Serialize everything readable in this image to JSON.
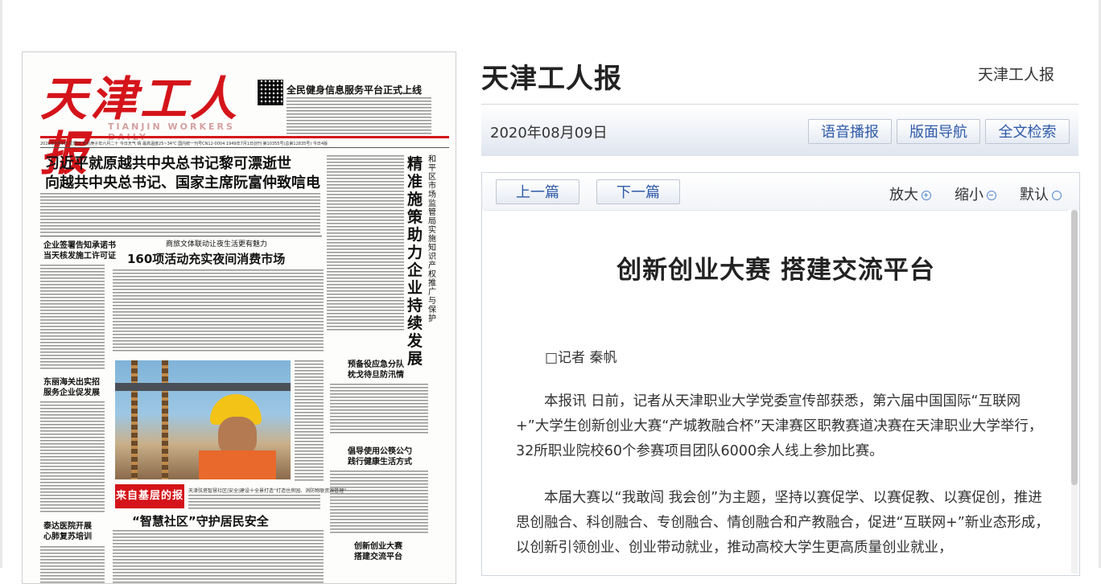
{
  "site": {
    "title": "天津工人报",
    "paper_name": "天津工人报"
  },
  "toolbar": {
    "date": "2020年08月09日",
    "buttons": [
      "语音播报",
      "版面导航",
      "全文检索"
    ]
  },
  "article_nav": {
    "prev_label": "上一篇",
    "next_label": "下一篇",
    "zoom_in_label": "放大",
    "zoom_out_label": "缩小",
    "zoom_default_label": "默认"
  },
  "article": {
    "title": "创新创业大赛 搭建交流平台",
    "byline": "□记者 秦帆",
    "paragraphs": [
      "本报讯 日前，记者从天津职业大学党委宣传部获悉，第六届中国国际“互联网+”大学生创新创业大赛“产城教融合杯”天津赛区职教赛道决赛在天津职业大学举行，32所职业院校60个参赛项目团队6000余人线上参加比赛。",
      "本届大赛以“我敢闯 我会创”为主题，坚持以赛促学、以赛促教、以赛促创，推进思创融合、科创融合、专创融合、情创融合和产教融合，促进“互联网+”新业态形成，以创新引领创业、创业带动就业，推动高校大学生更高质量创业就业，"
    ]
  },
  "newspaper": {
    "masthead": "天津工人报",
    "masthead_en": "TIANJIN WORKERS DAILY",
    "top_headline": "全民健身信息服务平台正式上线",
    "issue_line": "2020年8月9日 星期日 农历庚子年六月二十 今日天气 晴 最高温度25~34℃ 国内统一刊号CN12-0004 1949年7月1日创刊 第10355号(总第12835号) 今日4版",
    "lead_headline_1": "习近平就原越共中央总书记黎可漂逝世",
    "lead_headline_2": "向越共中央总书记、国家主席阮富仲致唁电",
    "vertical_headline": "精准施策助力企业持续发展",
    "vertical_subhead": "和平区市场监管局实施知识产权推广与保护",
    "left_col_head_1": "企业签署告知承诺书",
    "left_col_head_1b": "当天核发施工许可证",
    "mid_kicker": "商旅文体联动让夜生活更有魅力",
    "mid_headline": "160项活动充实夜间消费市场",
    "left_col_head_2": "东丽海关出实招",
    "left_col_head_2b": "服务企业促发展",
    "right_col_head_1": "预备役应急分队",
    "right_col_head_1b": "枕戈待旦防汛情",
    "right_col_head_2": "倡导使用公筷公勺",
    "right_col_head_2b": "践行健康生活方式",
    "right_col_head_3": "创新创业大赛",
    "right_col_head_3b": "搭建交流平台",
    "banner": "来自基层的报道",
    "bottom_headline": "“智慧社区”守护居民安全",
    "left_col_head_3": "泰达医院开展",
    "left_col_head_3b": "心肺复苏培训",
    "bottom_kicker": "天津弦塔智慧社区|安全|建设十全景打造“打造住房园、消防物联资源管理”",
    "photo_name": "worker-photo"
  }
}
